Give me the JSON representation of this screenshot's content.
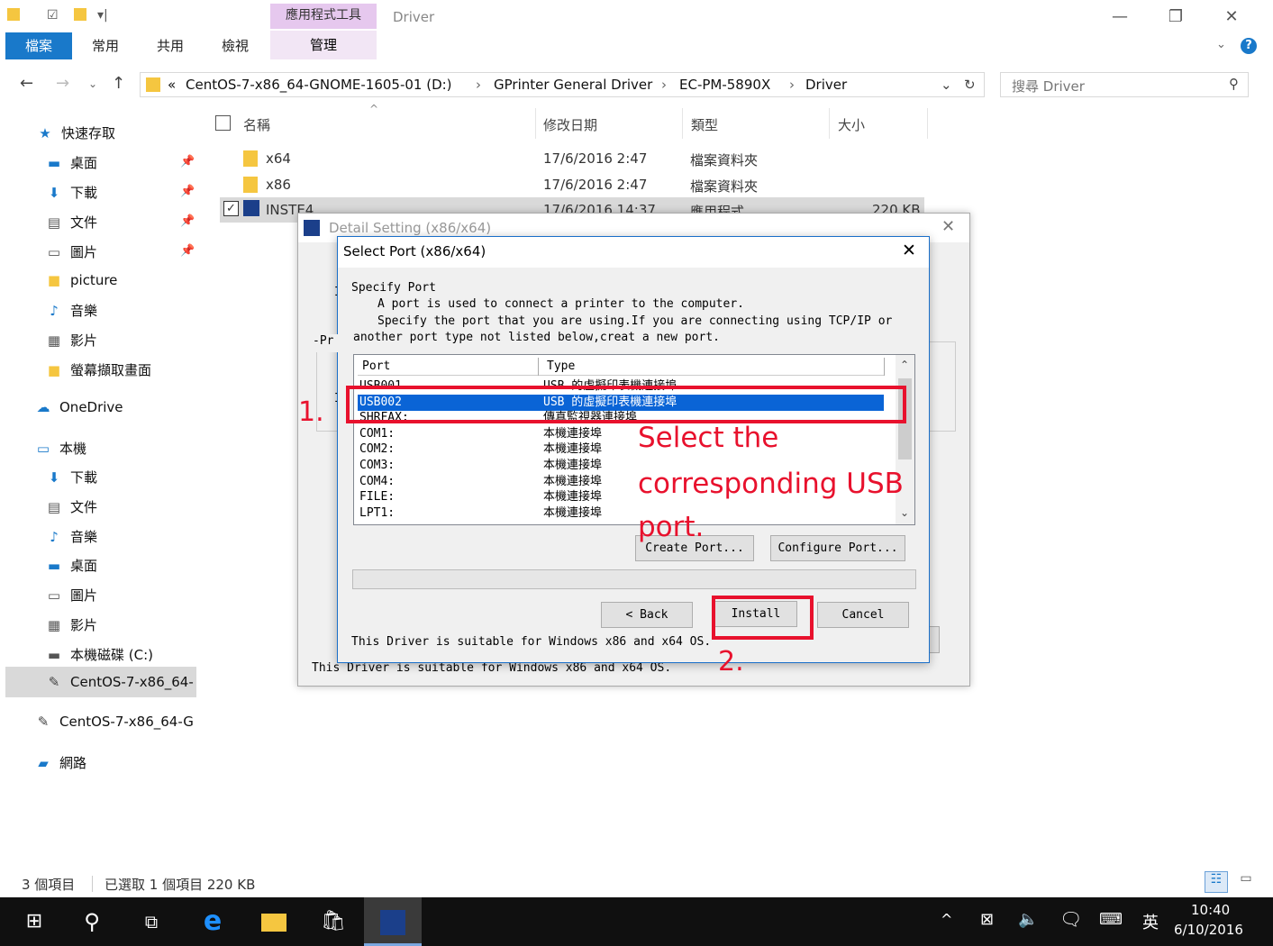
{
  "ribbon": {
    "context_group": "應用程式工具",
    "window_title": "Driver",
    "tabs": [
      "檔案",
      "常用",
      "共用",
      "檢視"
    ],
    "context_tab": "管理"
  },
  "address": {
    "crumbs": [
      "CentOS-7-x86_64-GNOME-1605-01 (D:)",
      "GPrinter General Driver",
      "EC-PM-5890X",
      "Driver"
    ],
    "search_placeholder": "搜尋 Driver"
  },
  "nav": {
    "quick_access": "快速存取",
    "items": [
      "桌面",
      "下載",
      "文件",
      "圖片",
      "picture",
      "音樂",
      "影片",
      "螢幕擷取畫面"
    ],
    "onedrive": "OneDrive",
    "this_pc": "本機",
    "pc_items": [
      "下載",
      "文件",
      "音樂",
      "桌面",
      "圖片",
      "影片",
      "本機磁碟 (C:)",
      "CentOS-7-x86_64-"
    ],
    "drive2": "CentOS-7-x86_64-G",
    "network": "網路"
  },
  "files": {
    "headers": [
      "名稱",
      "修改日期",
      "類型",
      "大小"
    ],
    "rows": [
      {
        "name": "x64",
        "date": "17/6/2016 2:47",
        "type": "檔案資料夾",
        "size": ""
      },
      {
        "name": "x86",
        "date": "17/6/2016 2:47",
        "type": "檔案資料夾",
        "size": ""
      },
      {
        "name": "INSTE4",
        "date": "17/6/2016 14:37",
        "type": "應用程式",
        "size": "220 KB"
      }
    ]
  },
  "back_dialog": {
    "title": "Detail Setting (x86/x64)",
    "footer": "This Driver is suitable for Windows x86 and x64 OS."
  },
  "dialog": {
    "title": "Select Port (x86/x64)",
    "heading": "Specify Port",
    "line1": "A port is used to connect a printer to the computer.",
    "line2": "Specify the port that you are using.If you are connecting using TCP/IP or",
    "line3": "another port type not listed below,creat a new port.",
    "col_port": "Port",
    "col_type": "Type",
    "ports": [
      {
        "port": "USB001",
        "type": "USB 的虛擬印表機連接埠"
      },
      {
        "port": "USB002",
        "type": "USB 的虛擬印表機連接埠"
      },
      {
        "port": "SHRFAX:",
        "type": "傳真監視器連接埠"
      },
      {
        "port": "COM1:",
        "type": "本機連接埠"
      },
      {
        "port": "COM2:",
        "type": "本機連接埠"
      },
      {
        "port": "COM3:",
        "type": "本機連接埠"
      },
      {
        "port": "COM4:",
        "type": "本機連接埠"
      },
      {
        "port": "FILE:",
        "type": "本機連接埠"
      },
      {
        "port": "LPT1:",
        "type": "本機連接埠"
      }
    ],
    "selected_index": 1,
    "create_port": "Create Port...",
    "configure_port": "Configure Port...",
    "back": "< Back",
    "install": "Install",
    "cancel": "Cancel",
    "footer": "This Driver is suitable for Windows x86 and x64 OS."
  },
  "annotations": {
    "step1": "1.",
    "step2": "2.",
    "line_a": "Select the",
    "line_b": "corresponding USB",
    "line_c": "port."
  },
  "status": {
    "count": "3 個項目",
    "selected": "已選取 1 個項目  220 KB"
  },
  "taskbar": {
    "time": "10:40",
    "date": "6/10/2016",
    "ime": "英"
  },
  "colors": {
    "accent": "#1979ca",
    "annotation": "#e8112d",
    "selection": "#0a64d6"
  }
}
